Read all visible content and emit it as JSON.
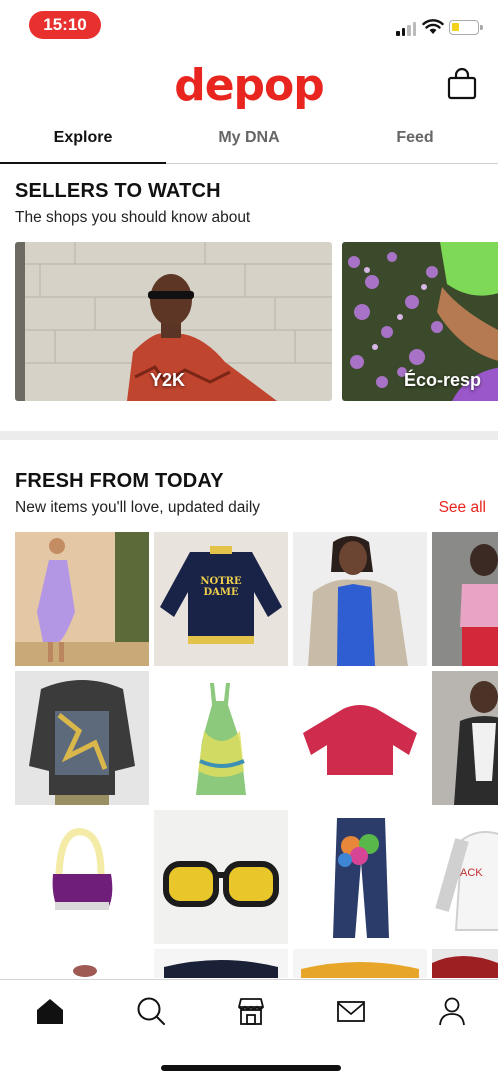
{
  "status": {
    "time": "15:10"
  },
  "header": {
    "logo": "depop"
  },
  "tabs": [
    {
      "label": "Explore",
      "active": true
    },
    {
      "label": "My DNA",
      "active": false
    },
    {
      "label": "Feed",
      "active": false
    }
  ],
  "sellers": {
    "title": "SELLERS TO WATCH",
    "subtitle": "The shops you should know about",
    "cards": [
      {
        "label": "Y2K"
      },
      {
        "label": "Éco-resp"
      }
    ]
  },
  "fresh": {
    "title": "FRESH FROM TODAY",
    "subtitle": "New items you'll love, updated daily",
    "see_all": "See all",
    "jacket_text": "NOTRE DAME"
  },
  "nav": {
    "items": [
      "home-icon",
      "search-icon",
      "shop-icon",
      "inbox-icon",
      "profile-icon"
    ]
  },
  "colors": {
    "brand": "#e8261f",
    "status_pill": "#e8312f"
  }
}
